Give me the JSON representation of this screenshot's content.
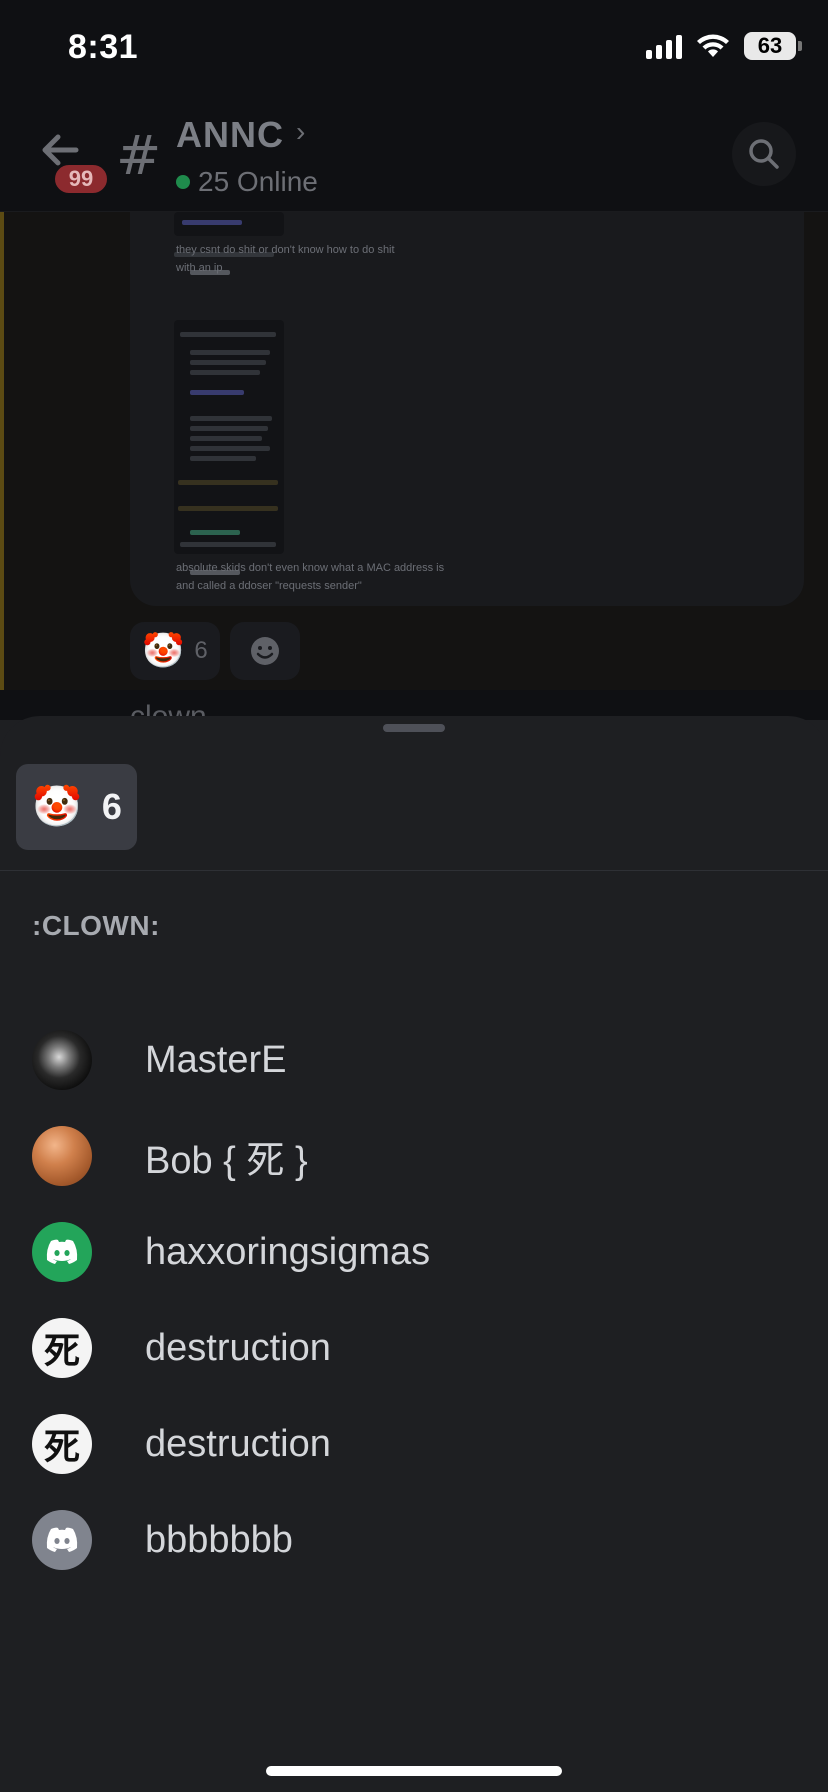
{
  "status_bar": {
    "time": "8:31",
    "battery": "63"
  },
  "header": {
    "channel_name": "ANNC",
    "online": "25 Online",
    "unread_badge": "99",
    "hash_glyph": "#",
    "chevron_glyph": "›"
  },
  "background_message": {
    "embed_lines": [
      "they csnt do shit or don't know how to do shit",
      "with an ip",
      "absolute skids don't even know what a MAC address is",
      "and called a ddoser \"requests sender\""
    ],
    "reaction_emoji": "🤡",
    "reaction_count": "6",
    "peek_text": "clown"
  },
  "sheet": {
    "tab_emoji": "🤡",
    "tab_count": "6",
    "emoji_name": ":CLOWN:",
    "users": [
      {
        "name": "MasterE",
        "avatar": "dark-portrait"
      },
      {
        "name": "Bob { 死 }",
        "avatar": "egg"
      },
      {
        "name": "haxxoringsigmas",
        "avatar": "discord-green"
      },
      {
        "name": "destruction",
        "avatar": "kanji",
        "avatar_glyph": "死"
      },
      {
        "name": "destruction",
        "avatar": "kanji",
        "avatar_glyph": "死"
      },
      {
        "name": "bbbbbbb",
        "avatar": "discord-grey"
      }
    ]
  },
  "colors": {
    "sheet_bg": "#1e1f22",
    "tab_bg": "#3a3c43",
    "online_green": "#23a55a",
    "badge_red": "#8c2a2e"
  }
}
